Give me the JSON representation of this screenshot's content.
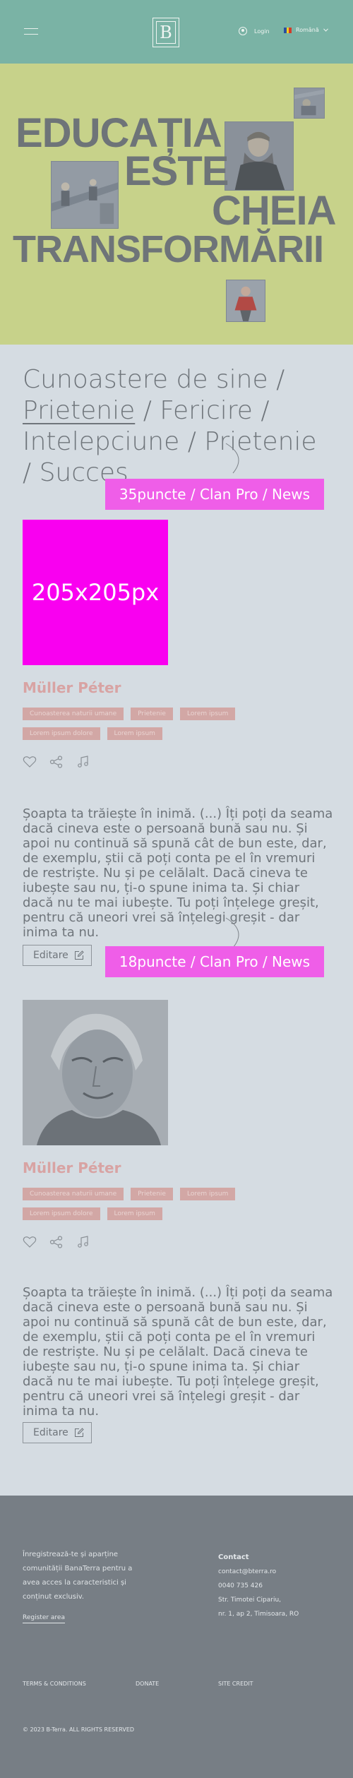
{
  "header": {
    "login_label": "Login",
    "language": "Română"
  },
  "hero": {
    "words": [
      "EDUCAȚIA",
      "ESTE",
      "CHEIA",
      "TRANSFORMĂRII"
    ]
  },
  "cards": [
    {
      "title_prefix": "Cunoastere de sine / ",
      "title_link": "Prietenie",
      "title_suffix": " / Fericire / Intelepciune / Prietenie / Succes",
      "promo": "35puncte / Clan Pro / News",
      "image_placeholder": "205x205px",
      "author": "Müller Péter",
      "tags": [
        "Cunoasterea naturii umane",
        "Prietenie",
        "Lorem ipsum",
        "Lorem ipsum dolore",
        "Lorem ipsum"
      ],
      "quote": "Șoapta ta trăiește în inimă. (...) Îți poți da seama dacă cineva este o persoană bună sau nu. Și apoi nu continuă să spună cât de bun este, dar, de exemplu, știi că poți conta pe el în vremuri de restriște. Nu și pe celălalt. Dacă cineva te iubește sau nu, ți-o spune inima ta. Și chiar dacă nu te mai iubește. Tu poți înțelege greșit, pentru că uneori vrei să înțelegi greșit - dar inima ta nu.",
      "edit_label": "Editare",
      "promo2": "18puncte / Clan Pro / News"
    },
    {
      "author": "Müller Péter",
      "tags": [
        "Cunoasterea naturii umane",
        "Prietenie",
        "Lorem ipsum",
        "Lorem ipsum dolore",
        "Lorem ipsum"
      ],
      "quote": "Șoapta ta trăiește în inimă. (...) Îți poți da seama dacă cineva este o persoană bună sau nu. Și apoi nu continuă să spună cât de bun este, dar, de exemplu, știi că poți conta pe el în vremuri de restriște. Nu și pe celălalt. Dacă cineva te iubește sau nu, ți-o spune inima ta. Și chiar dacă nu te mai iubește. Tu poți înțelege greșit, pentru că uneori vrei să înțelegi greșit - dar inima ta nu.",
      "edit_label": "Editare"
    }
  ],
  "footer": {
    "text": "Înregistrează-te și aparține comunității BanaTerra pentru a avea acces la caracteristici și conținut exclusiv.",
    "register": "Register area",
    "contact_heading": "Contact",
    "email": "contact@bterra.ro",
    "phone": "0040 735 426",
    "street": "Str. Timotei Cipariu,",
    "address": "nr. 1, ap 2, Timisoara, RO",
    "terms": "TERMS & CONDITIONS",
    "donate": "DONATE",
    "site_credit": "SITE CREDIT",
    "copyright": "© 2023 B-Terra. ALL RIGHTS RESERVED"
  },
  "colors": {
    "header_bg": "#7ab3a5",
    "hero_bg": "#c7d28a",
    "page_bg": "#d5dce2",
    "promo": "#ef5ee8",
    "placeholder": "#f900f0",
    "author": "#d8a3a3",
    "tag": "#d2a7a5",
    "footer_bg": "#777e85"
  },
  "icons": [
    "menu-icon",
    "logo",
    "user-icon",
    "flag-icon",
    "chevron-down-icon",
    "heart-icon",
    "share-icon",
    "music-icon",
    "edit-icon"
  ]
}
